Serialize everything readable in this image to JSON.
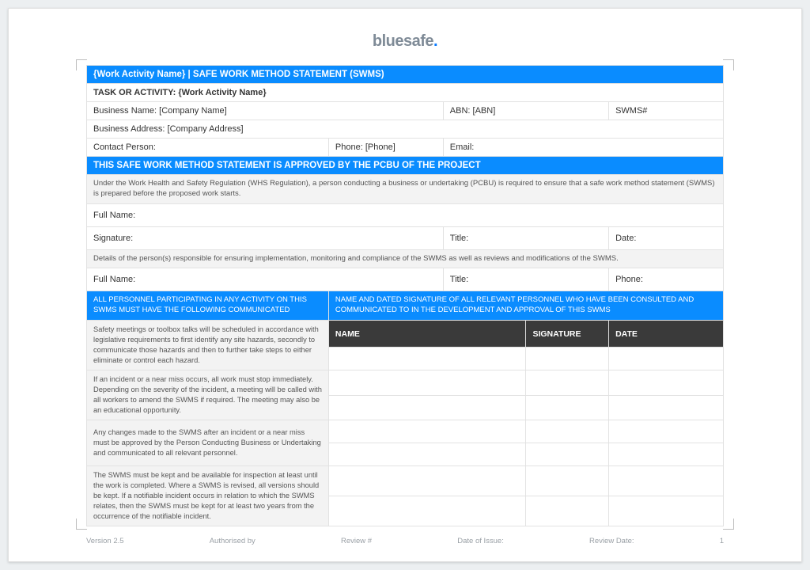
{
  "logo": {
    "brand": "bluesafe",
    "dot": "."
  },
  "header": {
    "title": "{Work Activity Name} | SAFE WORK METHOD STATEMENT (SWMS)",
    "task_row": "TASK OR ACTIVITY: {Work Activity Name}"
  },
  "info": {
    "business_name": "Business Name: [Company Name]",
    "abn": "ABN: [ABN]",
    "swms_no": "SWMS#",
    "business_address": "Business Address: [Company Address]",
    "contact_person": "Contact Person:",
    "phone": "Phone: [Phone]",
    "email": "Email:"
  },
  "approval_bar": "THIS SAFE WORK METHOD STATEMENT IS APPROVED BY THE PCBU OF THE PROJECT",
  "whs_text": "Under the Work Health and Safety Regulation (WHS Regulation), a person conducting a business or undertaking (PCBU) is required to ensure that a safe work method statement (SWMS) is prepared before the proposed work starts.",
  "approver": {
    "full_name": "Full Name:",
    "signature": "Signature:",
    "title": "Title:",
    "date": "Date:"
  },
  "responsible_text": "Details of the person(s) responsible for ensuring implementation, monitoring and compliance of the SWMS as well as reviews and modifications of the SWMS.",
  "responsible": {
    "full_name": "Full Name:",
    "title": "Title:",
    "phone": "Phone:"
  },
  "blue_left": "ALL PERSONNEL PARTICIPATING IN ANY ACTIVITY ON THIS SWMS MUST HAVE THE FOLLOWING COMMUNICATED",
  "blue_right": "NAME AND DATED SIGNATURE OF ALL RELEVANT PERSONNEL WHO HAVE BEEN CONSULTED AND COMMUNICATED TO IN THE DEVELOPMENT AND APPROVAL OF THIS SWMS",
  "sig_headers": {
    "name": "NAME",
    "signature": "SIGNATURE",
    "date": "DATE"
  },
  "paras": {
    "p1": "Safety meetings or toolbox talks will be scheduled in accordance with legislative requirements to first identify any site hazards, secondly to communicate those hazards and then to further take steps to either eliminate or control each hazard.",
    "p2": "If an incident or a near miss occurs, all work must stop immediately. Depending on the severity of the incident, a meeting will be called with all workers to amend the SWMS if required. The meeting may also be an educational opportunity.",
    "p3": "Any changes made to the SWMS after an incident or a near miss must be approved by the Person Conducting Business or Undertaking and communicated to all relevant personnel.",
    "p4": "The SWMS must be kept and be available for inspection at least until the work is completed. Where a SWMS is revised, all versions should be kept. If a notifiable incident occurs in relation to which the SWMS relates, then the SWMS must be kept for at least two years from the occurrence of the notifiable incident."
  },
  "footer": {
    "version": "Version 2.5",
    "auth": "Authorised by",
    "review": "Review #",
    "issue": "Date of Issue:",
    "reviewdate": "Review Date:",
    "page": "1"
  }
}
